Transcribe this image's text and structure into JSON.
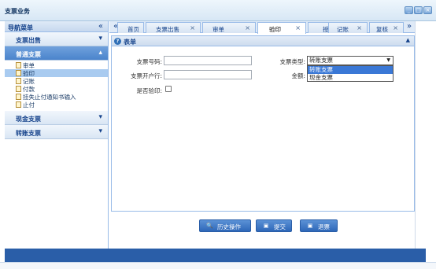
{
  "window": {
    "title": "支票业务",
    "controls": [
      "_",
      "□",
      "×"
    ]
  },
  "sidebar": {
    "title": "导航菜单",
    "collapse_glyph": "«",
    "groups": [
      {
        "label": "支票出售",
        "chevron": "▾",
        "active": false
      },
      {
        "label": "普通支票",
        "chevron": "▴",
        "active": true
      },
      {
        "label": "现金支票",
        "chevron": "▾",
        "active": false
      },
      {
        "label": "转账支票",
        "chevron": "▾",
        "active": false
      }
    ],
    "items": [
      {
        "label": "审单",
        "selected": false
      },
      {
        "label": "验印",
        "selected": true
      },
      {
        "label": "记账",
        "selected": false
      },
      {
        "label": "付款",
        "selected": false
      },
      {
        "label": "挂失止付通知书输入",
        "selected": false
      },
      {
        "label": "止付",
        "selected": false
      }
    ]
  },
  "tabs": {
    "scroll_left": "«",
    "scroll_right": "»",
    "items": [
      {
        "label": "首页",
        "closable": false,
        "active": false
      },
      {
        "label": "支票出售",
        "closable": true,
        "active": false
      },
      {
        "label": "审单",
        "closable": true,
        "active": false
      },
      {
        "label": "验印",
        "closable": true,
        "active": true
      },
      {
        "label": "授权",
        "closable": true,
        "active": false
      },
      {
        "label": "记账",
        "closable": true,
        "active": false
      },
      {
        "label": "复核",
        "closable": true,
        "active": false
      }
    ],
    "close_glyph": "×"
  },
  "form": {
    "panel_title": "表单",
    "help_glyph": "?",
    "collapse_glyph": "▲",
    "fields": {
      "check_number_label": "支票号码:",
      "check_number_value": "",
      "bank_label": "支票开户行:",
      "bank_value": "",
      "verify_label": "是否验印:",
      "verify_checked": false,
      "type_label": "支票类型:",
      "type_selected": "转账支票",
      "type_options": [
        "转账支票",
        "现金支票"
      ],
      "type_highlighted": "转账支票",
      "amount_label": "金额:",
      "amount_value": ""
    }
  },
  "buttons": {
    "history": "历史操作",
    "submit": "提交",
    "return": "退票"
  },
  "colors": {
    "accent": "#2a5ea8",
    "panel_border": "#99bbe8",
    "highlight": "#3a78d6"
  }
}
